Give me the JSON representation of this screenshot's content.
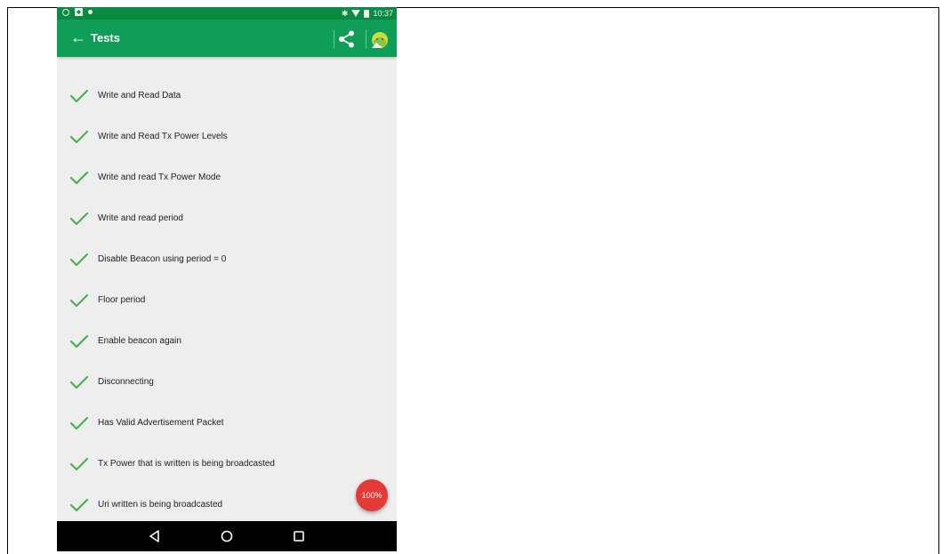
{
  "status_bar": {
    "time": "10:37",
    "icons": [
      "search-icon",
      "notification-icon",
      "location-icon",
      "bluetooth-icon",
      "wifi-icon",
      "battery-icon"
    ]
  },
  "app_bar": {
    "title": "Tests",
    "back_icon": "arrow-back-icon",
    "actions": [
      "share-icon",
      "android-icon"
    ]
  },
  "tests": [
    {
      "label": "Write and Read Data",
      "status": "passed"
    },
    {
      "label": "Write and Read Tx Power Levels",
      "status": "passed"
    },
    {
      "label": "Write and read Tx Power Mode",
      "status": "passed"
    },
    {
      "label": "Write and read period",
      "status": "passed"
    },
    {
      "label": "Disable Beacon using period = 0",
      "status": "passed"
    },
    {
      "label": "Floor period",
      "status": "passed"
    },
    {
      "label": "Enable beacon again",
      "status": "passed"
    },
    {
      "label": "Disconnecting",
      "status": "passed"
    },
    {
      "label": "Has Valid Advertisement Packet",
      "status": "passed"
    },
    {
      "label": "Tx Power that is written is being broadcasted",
      "status": "passed"
    },
    {
      "label": "Uri written is being broadcasted",
      "status": "passed"
    }
  ],
  "fab": {
    "label": "100%"
  },
  "nav_bar": {
    "buttons": [
      "back-triangle-icon",
      "home-circle-icon",
      "recents-square-icon"
    ]
  },
  "colors": {
    "status_bar": "#0b8a42",
    "app_bar": "#0f9d58",
    "check": "#4caf50",
    "fab": "#e53935",
    "background": "#eeeeee"
  }
}
